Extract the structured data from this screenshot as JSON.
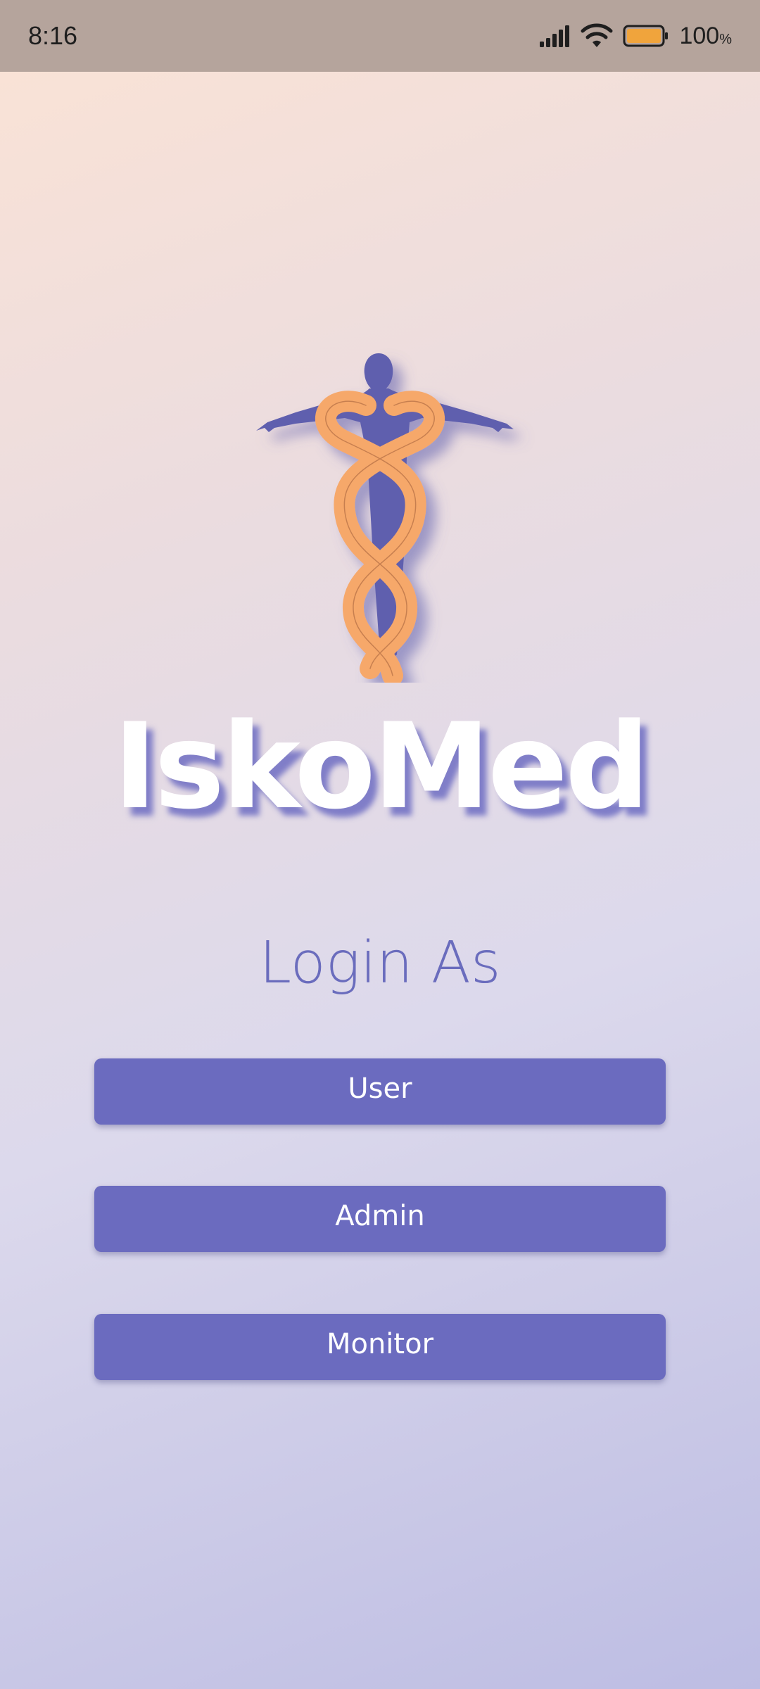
{
  "status_bar": {
    "time": "8:16",
    "battery_percent": "100",
    "battery_unit": "%",
    "icons": [
      "signal-icon",
      "wifi-icon",
      "battery-icon"
    ],
    "battery_color": "#f0a43c"
  },
  "logo": {
    "icon": "caduceus-figure-icon",
    "figure_color": "#5f5fae",
    "snake_color": "#f6a86b"
  },
  "app_name": "IskoMed",
  "login_prompt": "Login As",
  "buttons": {
    "user": "User",
    "admin": "Admin",
    "monitor": "Monitor"
  },
  "colors": {
    "accent": "#6b6bbf",
    "title": "#ffffff"
  }
}
